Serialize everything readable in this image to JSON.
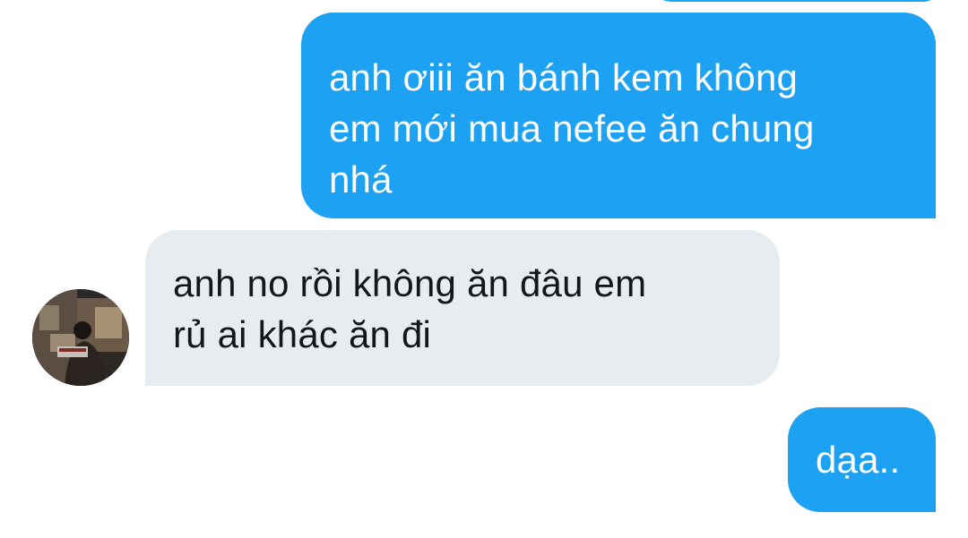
{
  "conversation": {
    "messages": [
      {
        "sender": "me",
        "text": "anh ơiii ăn bánh kem không\nem mới mua nefee ăn chung\nnhá"
      },
      {
        "sender": "other",
        "text": "anh no rồi không ăn đâu em\nrủ ai khác ăn đi"
      },
      {
        "sender": "me",
        "text": "dạa.."
      }
    ],
    "colors": {
      "sent_bubble": "#1da1f2",
      "received_bubble": "#e6ecf0",
      "received_text": "#14171a"
    },
    "avatar_icon": "user-avatar-photo"
  }
}
